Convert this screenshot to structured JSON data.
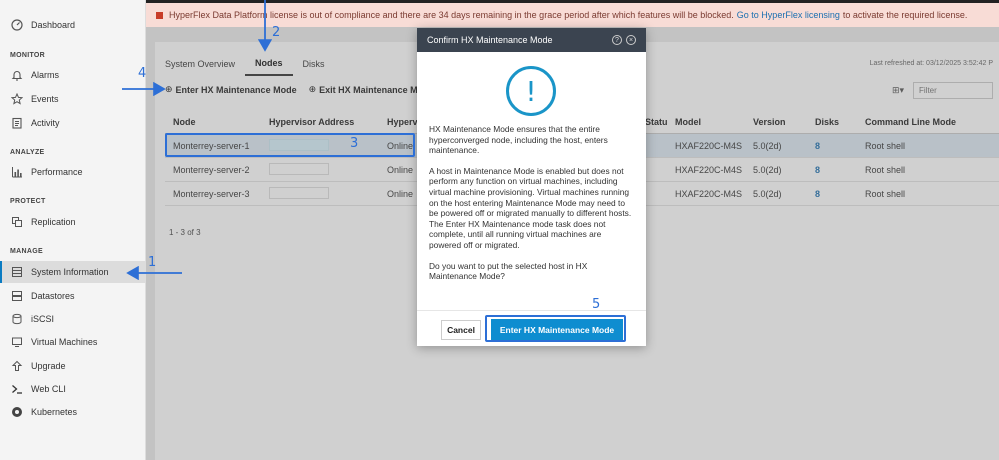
{
  "banner": {
    "text": "HyperFlex Data Platform license is out of compliance and there are 34 days remaining in the grace period after which features will be blocked.",
    "link": "Go to HyperFlex licensing",
    "suffix": "to activate the required license."
  },
  "sidebar": {
    "dashboard": "Dashboard",
    "sections": {
      "monitor": "MONITOR",
      "analyze": "ANALYZE",
      "protect": "PROTECT",
      "manage": "MANAGE"
    },
    "items": {
      "alarms": "Alarms",
      "events": "Events",
      "activity": "Activity",
      "performance": "Performance",
      "replication": "Replication",
      "system_information": "System Information",
      "datastores": "Datastores",
      "iscsi": "iSCSI",
      "virtual_machines": "Virtual Machines",
      "upgrade": "Upgrade",
      "web_cli": "Web CLI",
      "kubernetes": "Kubernetes"
    }
  },
  "tabs": {
    "system_overview": "System Overview",
    "nodes": "Nodes",
    "disks": "Disks"
  },
  "last_refreshed": "Last refreshed at: 03/12/2025 3:52:42 P",
  "toolbar": {
    "enter": "Enter HX Maintenance Mode",
    "exit": "Exit HX Maintenance Mode"
  },
  "filter": {
    "placeholder": "Filter"
  },
  "table": {
    "headers": {
      "node": "Node",
      "hypervisor_address": "Hypervisor Address",
      "hypervisor_status": "Hyperv",
      "maintenance_status": "r Status",
      "model": "Model",
      "version": "Version",
      "disks": "Disks",
      "command_line_mode": "Command Line Mode"
    },
    "rows": [
      {
        "node": "Monterrey-server-1",
        "status": "Online",
        "model": "HXAF220C-M4S",
        "version": "5.0(2d)",
        "disks": "8",
        "cmd": "Root shell"
      },
      {
        "node": "Monterrey-server-2",
        "status": "Online",
        "model": "HXAF220C-M4S",
        "version": "5.0(2d)",
        "disks": "8",
        "cmd": "Root shell"
      },
      {
        "node": "Monterrey-server-3",
        "status": "Online",
        "model": "HXAF220C-M4S",
        "version": "5.0(2d)",
        "disks": "8",
        "cmd": "Root shell"
      }
    ],
    "count": "1 - 3 of 3"
  },
  "modal": {
    "title": "Confirm HX Maintenance Mode",
    "icon": "!",
    "p1": "HX Maintenance Mode ensures that the entire hyperconverged node, including the host, enters maintenance.",
    "p2": "A host in Maintenance Mode is enabled but does not perform any function on virtual machines, including virtual machine provisioning. Virtual machines running on the host entering Maintenance Mode may need to be powered off or migrated manually to different hosts. The Enter HX Maintenance mode task does not complete, until all running virtual machines are powered off or migrated.",
    "p3": "Do you want to put the selected host in HX Maintenance Mode?",
    "cancel": "Cancel",
    "confirm": "Enter HX Maintenance Mode"
  },
  "annotations": {
    "n1": "1",
    "n2": "2",
    "n3": "3",
    "n4": "4",
    "n5": "5"
  },
  "colors": {
    "accent": "#0e8dd0",
    "annotation": "#2d6fd6",
    "banner_bg": "#f8dcd6",
    "modal_header": "#3b4450"
  }
}
